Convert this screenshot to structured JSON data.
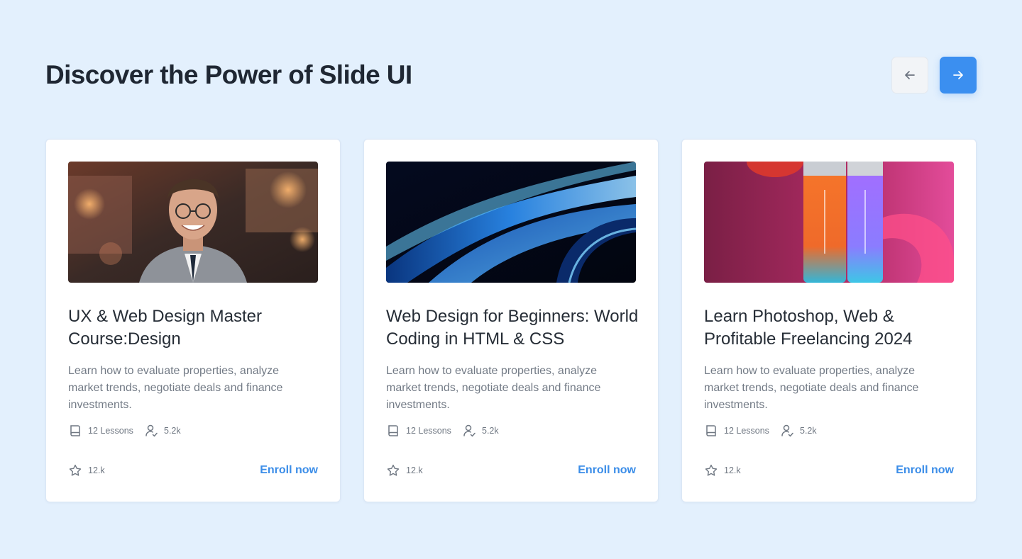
{
  "header": {
    "title": "Discover the Power of Slide UI",
    "prev_icon": "arrow-left-icon",
    "next_icon": "arrow-right-icon"
  },
  "colors": {
    "background": "#e3f0fd",
    "accent": "#3b8ff0",
    "title_text": "#1f2733",
    "muted_text": "#737b86"
  },
  "cards": [
    {
      "image": "portrait of smiling man with glasses",
      "title": "UX & Web Design Master Course:Design",
      "description": "Learn how to evaluate properties, analyze market trends, negotiate deals and finance investments.",
      "lessons": "12 Lessons",
      "students": "5.2k",
      "rating": "12.k",
      "cta": "Enroll now"
    },
    {
      "image": "abstract blue waves",
      "title": "Web Design for Beginners: World Coding in HTML & CSS",
      "description": "Learn how to evaluate properties, analyze market trends, negotiate deals and finance investments.",
      "lessons": "12 Lessons",
      "students": "5.2k",
      "rating": "12.k",
      "cta": "Enroll now"
    },
    {
      "image": "orange and purple bottles on pink background",
      "title": "Learn Photoshop, Web & Profitable Freelancing 2024",
      "description": "Learn how to evaluate properties, analyze market trends, negotiate deals and finance investments.",
      "lessons": "12 Lessons",
      "students": "5.2k",
      "rating": "12.k",
      "cta": "Enroll now"
    }
  ]
}
